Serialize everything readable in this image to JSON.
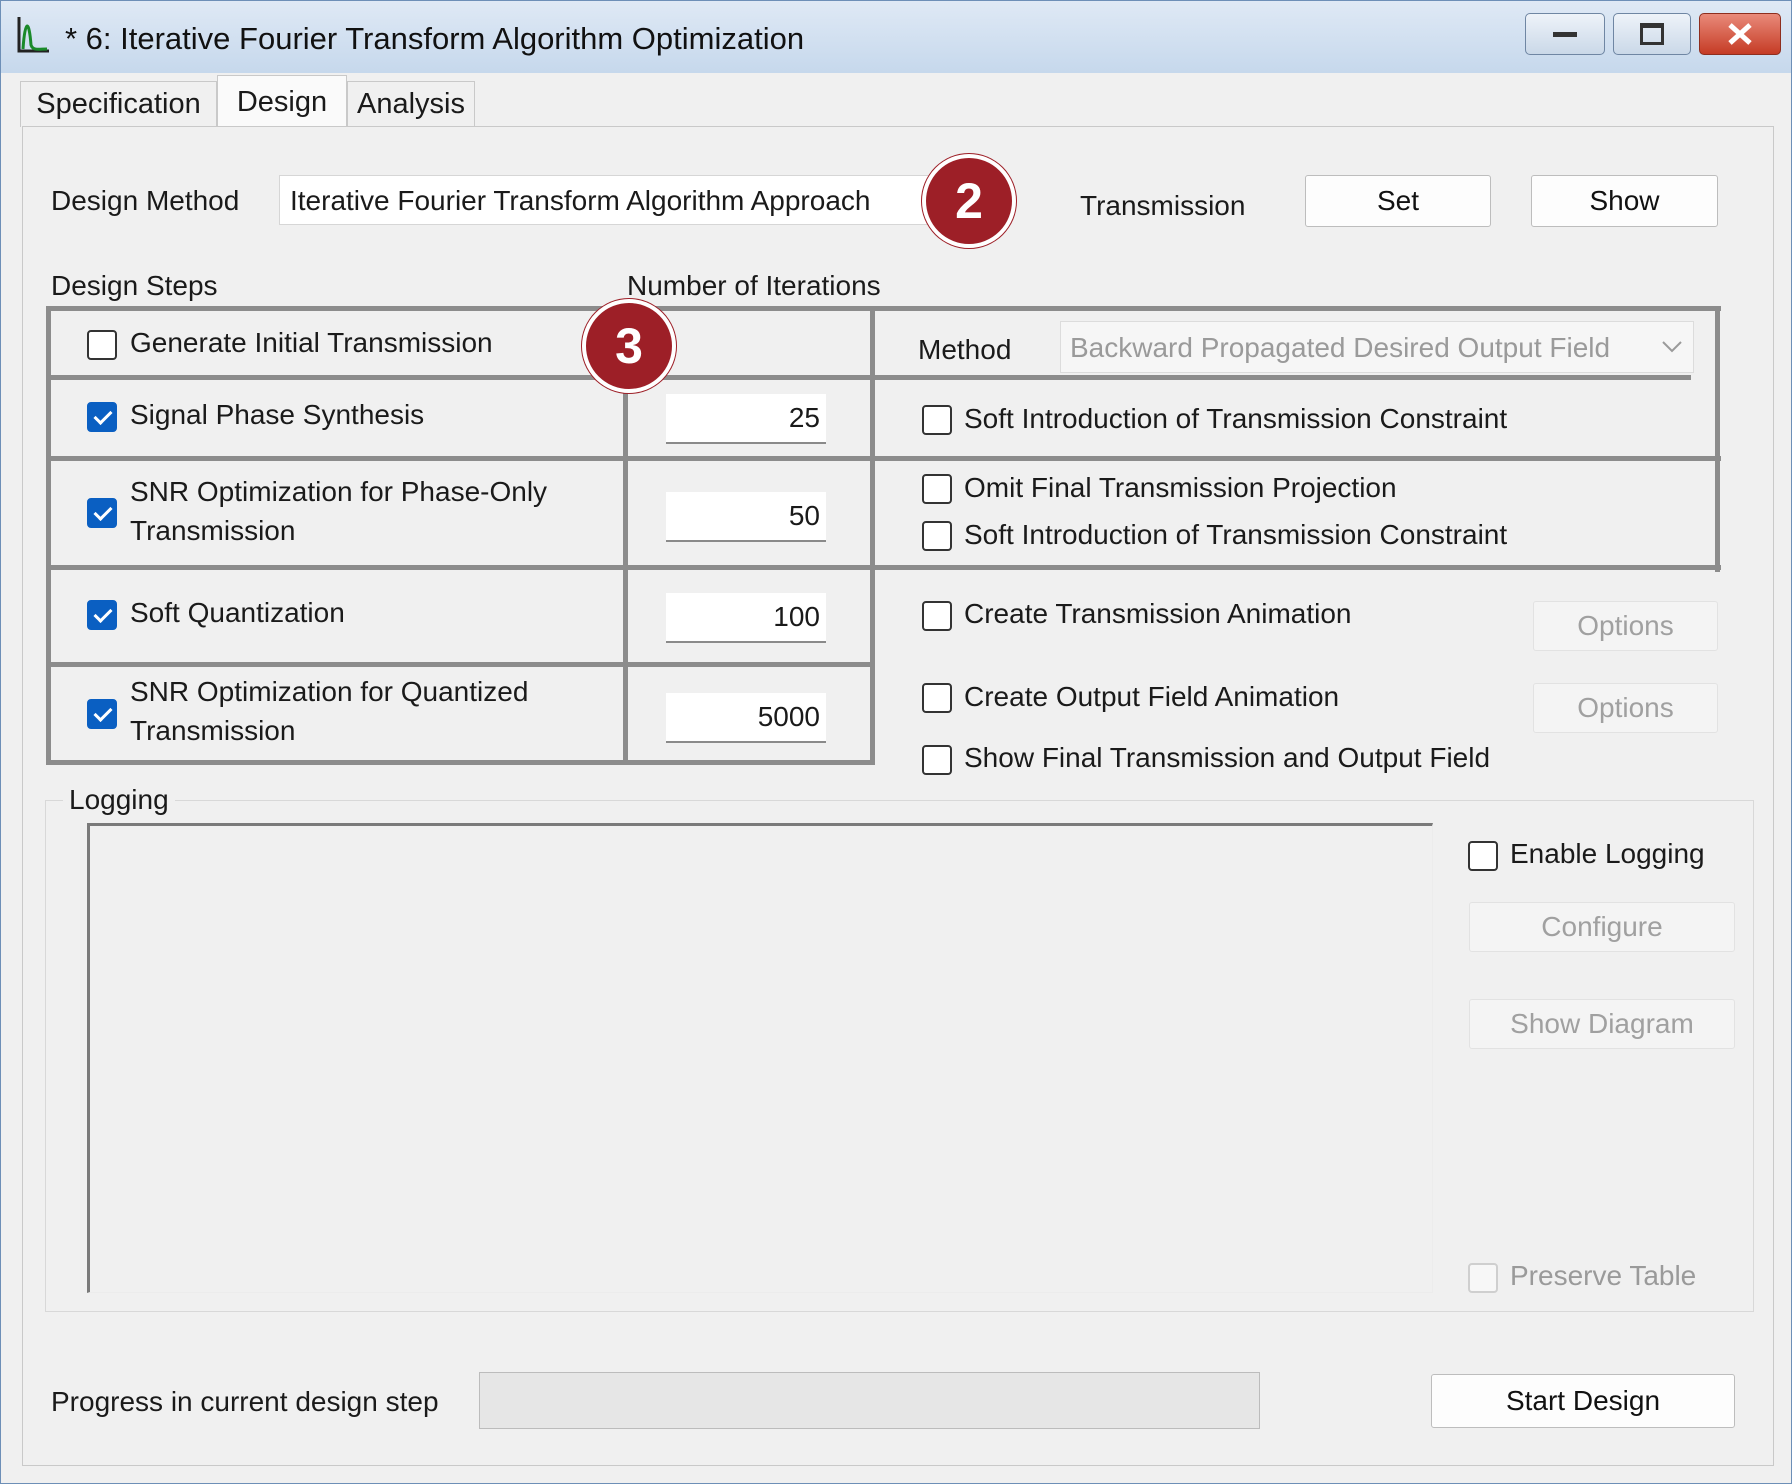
{
  "window": {
    "title": "* 6: Iterative Fourier Transform Algorithm Optimization"
  },
  "tabs": [
    "Specification",
    "Design",
    "Analysis"
  ],
  "design": {
    "method_label": "Design Method",
    "method_value": "Iterative Fourier Transform Algorithm Approach",
    "transmission_label": "Transmission",
    "set_button": "Set",
    "show_button": "Show",
    "steps_header": "Design Steps",
    "iterations_header": "Number of Iterations",
    "steps": [
      {
        "label": "Generate Initial Transmission",
        "checked": false,
        "iterations": ""
      },
      {
        "label": "Signal Phase Synthesis",
        "checked": true,
        "iterations": "25"
      },
      {
        "label_line1": "SNR Optimization for Phase-Only",
        "label_line2": "Transmission",
        "checked": true,
        "iterations": "50"
      },
      {
        "label": "Soft Quantization",
        "checked": true,
        "iterations": "100"
      },
      {
        "label_line1": "SNR Optimization for Quantized",
        "label_line2": "Transmission",
        "checked": true,
        "iterations": "5000"
      }
    ],
    "options": {
      "method_label": "Method",
      "method_value": "Backward Propagated Desired Output Field",
      "soft_intro_1": "Soft Introduction of Transmission Constraint",
      "omit_final": "Omit Final Transmission Projection",
      "soft_intro_2": "Soft Introduction of Transmission Constraint",
      "create_transmission_anim": "Create Transmission Animation",
      "create_output_anim": "Create Output Field Animation",
      "show_final": "Show Final Transmission and Output Field",
      "options_button": "Options"
    }
  },
  "logging": {
    "group_label": "Logging",
    "enable_label": "Enable Logging",
    "configure_button": "Configure",
    "show_diagram_button": "Show Diagram",
    "preserve_table_label": "Preserve Table"
  },
  "footer": {
    "progress_label": "Progress in current design step",
    "progress": 0,
    "start_button": "Start Design"
  },
  "annotations": {
    "badge_2": "2",
    "badge_3": "3"
  },
  "colors": {
    "accent": "#0a5fc2",
    "badge": "#9d1f27",
    "close": "#c53b25"
  }
}
